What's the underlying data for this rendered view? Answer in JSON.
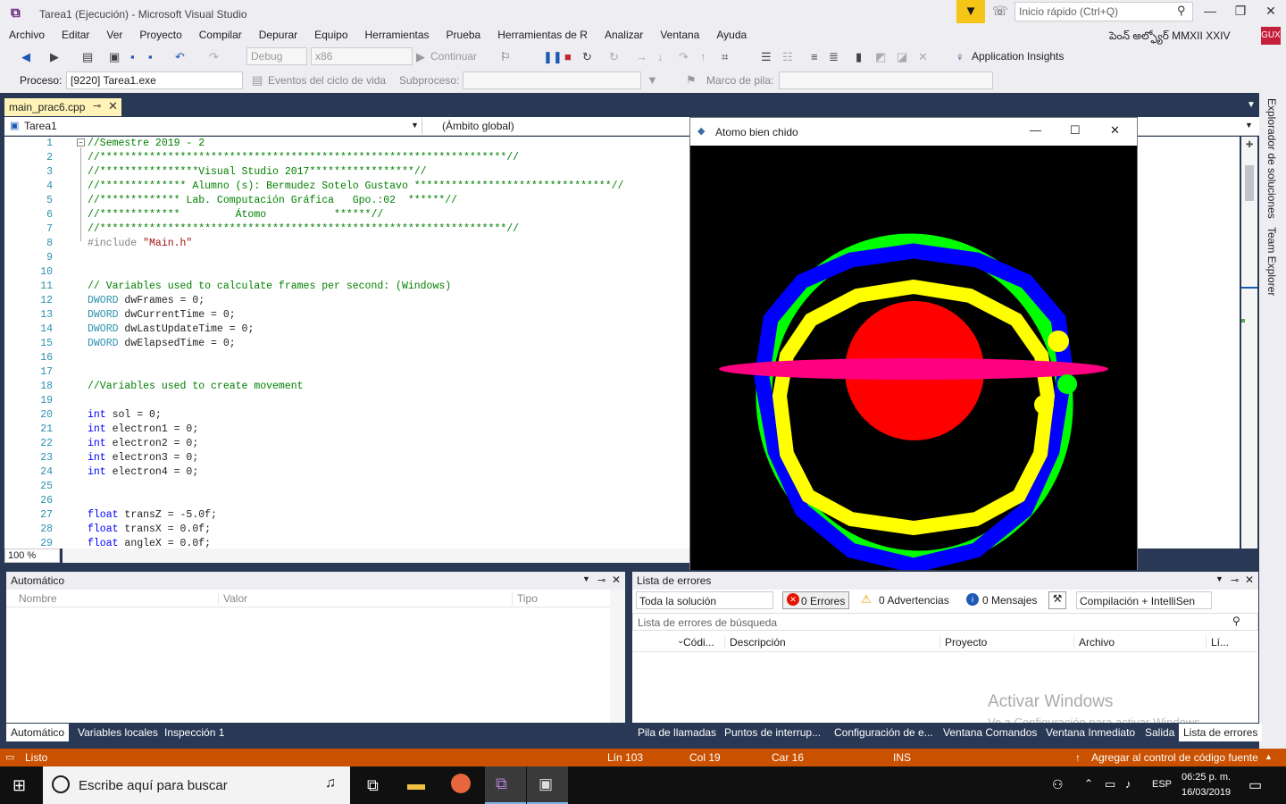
{
  "window": {
    "title": "Tarea1 (Ejecución) - Microsoft Visual Studio"
  },
  "quick_launch": {
    "placeholder": "Inicio rápido (Ctrl+Q)"
  },
  "menu": [
    "Archivo",
    "Editar",
    "Ver",
    "Proyecto",
    "Compilar",
    "Depurar",
    "Equipo",
    "Herramientas",
    "Prueba",
    "Herramientas de R",
    "Analizar",
    "Ventana",
    "Ayuda"
  ],
  "user": {
    "name": "పెంన్ అల్ఫ్యోర్ MMXII XXIV",
    "badge": "GUX"
  },
  "toolbar": {
    "config": "Debug",
    "platform": "x86",
    "continue": "Continuar",
    "app_insights": "Application Insights"
  },
  "toolbar2": {
    "process_label": "Proceso:",
    "process_value": "[9220] Tarea1.exe",
    "lifecycle": "Eventos del ciclo de vida",
    "thread_label": "Subproceso:",
    "stack_label": "Marco de pila:"
  },
  "editor": {
    "tab": "main_prac6.cpp",
    "project": "Tarea1",
    "scope": "(Ámbito global)",
    "zoom": "100 %",
    "lines": [
      {
        "n": "1",
        "t": "//Semestre 2019 - 2",
        "c": "cm"
      },
      {
        "n": "2",
        "t": "//******************************************************************//",
        "c": "cm"
      },
      {
        "n": "3",
        "t": "//****************Visual Studio 2017*****************//",
        "c": "cm"
      },
      {
        "n": "4",
        "t": "//************** Alumno (s): Bermudez Sotelo Gustavo ********************************//",
        "c": "cm"
      },
      {
        "n": "5",
        "t": "//************* Lab. Computación Gráfica   Gpo.:02  ******//",
        "c": "cm"
      },
      {
        "n": "6",
        "t": "//*************         Átomo           ******//",
        "c": "cm"
      },
      {
        "n": "7",
        "t": "//******************************************************************//",
        "c": "cm"
      },
      {
        "n": "8",
        "t": "#include \"Main.h\"",
        "c": "pp"
      },
      {
        "n": "9",
        "t": "",
        "c": ""
      },
      {
        "n": "10",
        "t": "",
        "c": ""
      },
      {
        "n": "11",
        "t": "// Variables used to calculate frames per second: (Windows)",
        "c": "cm"
      },
      {
        "n": "12",
        "t": "DWORD dwFrames = 0;",
        "c": "dw"
      },
      {
        "n": "13",
        "t": "DWORD dwCurrentTime = 0;",
        "c": "dw"
      },
      {
        "n": "14",
        "t": "DWORD dwLastUpdateTime = 0;",
        "c": "dw"
      },
      {
        "n": "15",
        "t": "DWORD dwElapsedTime = 0;",
        "c": "dw"
      },
      {
        "n": "16",
        "t": "",
        "c": ""
      },
      {
        "n": "17",
        "t": "",
        "c": ""
      },
      {
        "n": "18",
        "t": "//Variables used to create movement",
        "c": "cm"
      },
      {
        "n": "19",
        "t": "",
        "c": ""
      },
      {
        "n": "20",
        "t": "int sol = 0;",
        "c": "int"
      },
      {
        "n": "21",
        "t": "int electron1 = 0;",
        "c": "int"
      },
      {
        "n": "22",
        "t": "int electron2 = 0;",
        "c": "int"
      },
      {
        "n": "23",
        "t": "int electron3 = 0;",
        "c": "int"
      },
      {
        "n": "24",
        "t": "int electron4 = 0;",
        "c": "int"
      },
      {
        "n": "25",
        "t": "",
        "c": ""
      },
      {
        "n": "26",
        "t": "",
        "c": ""
      },
      {
        "n": "27",
        "t": "float transZ = -5.0f;",
        "c": "fl"
      },
      {
        "n": "28",
        "t": "float transX = 0.0f;",
        "c": "fl"
      },
      {
        "n": "29",
        "t": "float angleX = 0.0f;",
        "c": "fl"
      }
    ]
  },
  "side_tabs": [
    "Explorador de soluciones",
    "Team Explorer"
  ],
  "gl_window": {
    "title": "Atomo bien chido"
  },
  "auto_panel": {
    "title": "Automático",
    "cols": [
      "Nombre",
      "Valor",
      "Tipo"
    ],
    "tabs": [
      "Automático",
      "Variables locales",
      "Inspección 1"
    ]
  },
  "errors_panel": {
    "title": "Lista de errores",
    "scope": "Toda la solución",
    "errors": "0 Errores",
    "warnings": "0 Advertencias",
    "messages": "0 Mensajes",
    "build": "Compilación + IntelliSen",
    "search": "Lista de errores de búsqueda",
    "cols": [
      "Códi...",
      "Descripción",
      "Proyecto",
      "Archivo",
      "Lí..."
    ],
    "tabs": [
      "Pila de llamadas",
      "Puntos de interrup...",
      "Configuración de e...",
      "Ventana Comandos",
      "Ventana Inmediato",
      "Salida",
      "Lista de errores"
    ],
    "watermark1": "Activar Windows",
    "watermark2": "Ve a Configuración para activar Windows."
  },
  "status": {
    "ready": "Listo",
    "line": "Lín 103",
    "col": "Col 19",
    "car": "Car 16",
    "ins": "INS",
    "source_control": "Agregar al control de código fuente"
  },
  "taskbar": {
    "search": "Escribe aquí para buscar",
    "lang": "ESP",
    "time": "06:25 p. m.",
    "date": "16/03/2019"
  }
}
